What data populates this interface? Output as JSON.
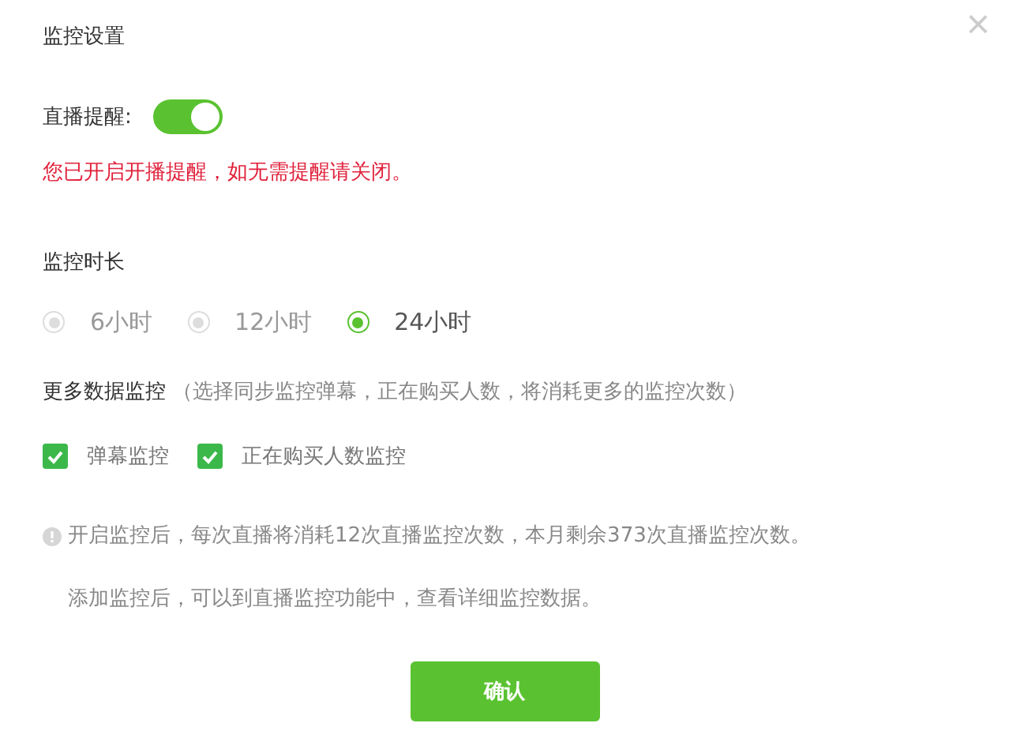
{
  "dialog": {
    "title": "监控设置",
    "close": "×"
  },
  "reminder": {
    "label": "直播提醒:",
    "on": true,
    "warning": "您已开启开播提醒，如无需提醒请关闭。"
  },
  "duration": {
    "label": "监控时长",
    "options": [
      {
        "label": "6小时",
        "selected": false,
        "disabled": true
      },
      {
        "label": "12小时",
        "selected": false,
        "disabled": true
      },
      {
        "label": "24小时",
        "selected": true,
        "disabled": false
      }
    ]
  },
  "more_data": {
    "label": "更多数据监控",
    "hint": "（选择同步监控弹幕，正在购买人数，将消耗更多的监控次数）",
    "options": [
      {
        "label": "弹幕监控",
        "checked": true
      },
      {
        "label": "正在购买人数监控",
        "checked": true
      }
    ]
  },
  "notes": [
    "开启监控后，每次直播将消耗12次直播监控次数，本月剩余373次直播监控次数。",
    "添加监控后，可以到直播监控功能中，查看详细监控数据。"
  ],
  "confirm_button": "确认"
}
